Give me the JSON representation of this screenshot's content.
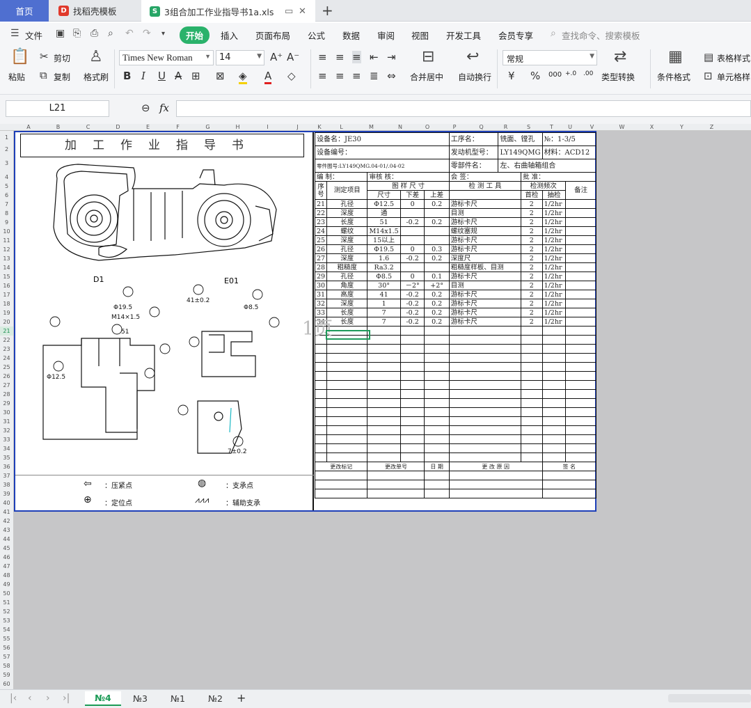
{
  "tabs": {
    "home": "首页",
    "template": "找稻壳模板",
    "file": "3组合加工作业指导书1a.xls",
    "new_tab": "+"
  },
  "menu": {
    "file": "文件",
    "items": [
      "开始",
      "插入",
      "页面布局",
      "公式",
      "数据",
      "审阅",
      "视图",
      "开发工具",
      "会员专享"
    ],
    "search": "查找命令、搜索模板"
  },
  "ribbon": {
    "paste": "粘贴",
    "cut": "剪切",
    "copy": "复制",
    "format_painter": "格式刷",
    "font_name": "Times New Roman",
    "font_size": "14",
    "merge_center": "合并居中",
    "wrap_text": "自动换行",
    "number_format": "常规",
    "type_convert": "类型转换",
    "conditional_format": "条件格式",
    "table_style": "表格样式",
    "cell_style": "单元格样"
  },
  "formula_bar": {
    "cell_ref": "L21",
    "fx": "fx",
    "content": ""
  },
  "columns": [
    "A",
    "B",
    "C",
    "D",
    "E",
    "F",
    "G",
    "H",
    "I",
    "J",
    "K",
    "L",
    "M",
    "N",
    "O",
    "P",
    "Q",
    "R",
    "S",
    "T",
    "U",
    "V",
    "W",
    "X",
    "Y",
    "Z"
  ],
  "active_row": "21",
  "sheet": {
    "title": "加工作业指导书",
    "drawing_labels": {
      "d1": "D1",
      "e01": "E01"
    },
    "watermark": "1页",
    "legend": {
      "clamp": "：压紧点",
      "support": "：支承点",
      "locate": "：定位点",
      "aux": "：辅助支承"
    },
    "header": {
      "equip_name": "设备名：JE30",
      "equip_no": "设备编号：",
      "process_label": "工序名：",
      "process_value": "铣面、镗孔",
      "no_label": "№：1-3/5",
      "engine_label": "发动机型号：",
      "engine_value": "LY149QMG",
      "material": "材料：ACD12",
      "part_drawing": "零件图号:LY149QMG.04-01/.04-02",
      "part_name_label": "零部件名：",
      "part_name_value": "左、右曲轴箱组合",
      "compiled": "编 制：",
      "reviewed": "审核 核：",
      "signed": "会 签：",
      "approved": "批 准：",
      "col_seq": "序号",
      "col_item": "测定项目",
      "col_dim": "图 样 尺 寸",
      "col_tool": "检 测 工 具",
      "col_freq": "检测频次",
      "col_note": "备注",
      "sub_size": "尺寸",
      "sub_lower": "下差",
      "sub_upper": "上差",
      "sub_first": "首检",
      "sub_sample": "抽检"
    },
    "rows": [
      {
        "no": "21",
        "item": "孔径",
        "size": "Φ12.5",
        "lo": "0",
        "hi": "0.2",
        "tool": "游标卡尺",
        "first": "2",
        "sample": "1/2hr"
      },
      {
        "no": "22",
        "item": "深度",
        "size": "通",
        "lo": "",
        "hi": "",
        "tool": "目测",
        "first": "2",
        "sample": "1/2hr"
      },
      {
        "no": "23",
        "item": "长度",
        "size": "51",
        "lo": "-0.2",
        "hi": "0.2",
        "tool": "游标卡尺",
        "first": "2",
        "sample": "1/2hr"
      },
      {
        "no": "24",
        "item": "螺纹",
        "size": "M14x1.5",
        "lo": "",
        "hi": "",
        "tool": "螺纹塞规",
        "first": "2",
        "sample": "1/2hr"
      },
      {
        "no": "25",
        "item": "深度",
        "size": "15以上",
        "lo": "",
        "hi": "",
        "tool": "游标卡尺",
        "first": "2",
        "sample": "1/2hr"
      },
      {
        "no": "26",
        "item": "孔径",
        "size": "Φ19.5",
        "lo": "0",
        "hi": "0.3",
        "tool": "游标卡尺",
        "first": "2",
        "sample": "1/2hr"
      },
      {
        "no": "27",
        "item": "深度",
        "size": "1.6",
        "lo": "-0.2",
        "hi": "0.2",
        "tool": "深度尺",
        "first": "2",
        "sample": "1/2hr"
      },
      {
        "no": "28",
        "item": "粗糙度",
        "size": "Ra3.2",
        "lo": "",
        "hi": "",
        "tool": "粗糙度样板、目测",
        "first": "2",
        "sample": "1/2hr"
      },
      {
        "no": "29",
        "item": "孔径",
        "size": "Φ8.5",
        "lo": "0",
        "hi": "0.1",
        "tool": "游标卡尺",
        "first": "2",
        "sample": "1/2hr"
      },
      {
        "no": "30",
        "item": "角度",
        "size": "30°",
        "lo": "－2°",
        "hi": "+2°",
        "tool": "目测",
        "first": "2",
        "sample": "1/2hr"
      },
      {
        "no": "31",
        "item": "高度",
        "size": "41",
        "lo": "-0.2",
        "hi": "0.2",
        "tool": "游标卡尺",
        "first": "2",
        "sample": "1/2hr"
      },
      {
        "no": "32",
        "item": "深度",
        "size": "1",
        "lo": "-0.2",
        "hi": "0.2",
        "tool": "游标卡尺",
        "first": "2",
        "sample": "1/2hr"
      },
      {
        "no": "33",
        "item": "长度",
        "size": "7",
        "lo": "-0.2",
        "hi": "0.2",
        "tool": "游标卡尺",
        "first": "2",
        "sample": "1/2hr"
      },
      {
        "no": "34",
        "item": "长度",
        "size": "7",
        "lo": "-0.2",
        "hi": "0.2",
        "tool": "游标卡尺",
        "first": "2",
        "sample": "1/2hr"
      }
    ],
    "footer": {
      "change_mark": "更改标记",
      "change_no": "更改单号",
      "date": "日 期",
      "reason": "更 改 原 因",
      "sign": "签 名"
    }
  },
  "sheet_tabs": [
    "№4",
    "№3",
    "№1",
    "№2"
  ]
}
